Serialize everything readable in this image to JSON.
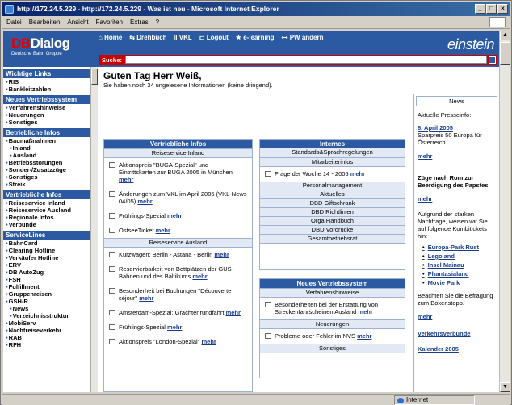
{
  "window": {
    "title": "http://172.24.5.229 - http://172.24.5.229 - Was ist neu - Microsoft Internet Explorer"
  },
  "menubar": [
    "Datei",
    "Bearbeiten",
    "Ansicht",
    "Favoriten",
    "Extras",
    "?"
  ],
  "header": {
    "brand_db": "DB",
    "brand_dialog": "Dialog",
    "brand_sub": "Deutsche Bahn Gruppe",
    "nav": [
      "Home",
      "Drehbuch",
      "VKL",
      "Logout",
      "e-learning",
      "PW ändern"
    ],
    "einstein": "einstein",
    "search_label": "Suche:"
  },
  "leftnav": [
    {
      "head": "Wichtige Links",
      "items": [
        {
          "t": "RIS"
        },
        {
          "t": "Bankleitzahlen"
        }
      ]
    },
    {
      "head": "Neues Vertriebssystem",
      "items": [
        {
          "t": "Verfahrenshinweise"
        },
        {
          "t": "Neuerungen"
        },
        {
          "t": "Sonstiges"
        }
      ]
    },
    {
      "head": "Betriebliche Infos",
      "items": [
        {
          "t": "Baumaßnahmen"
        },
        {
          "t": "Inland",
          "sub": true
        },
        {
          "t": "Ausland",
          "sub": true
        },
        {
          "t": "Betriebsstörungen"
        },
        {
          "t": "Sonder-/Zusatzzüge"
        },
        {
          "t": "Sonstiges"
        },
        {
          "t": "Streik"
        }
      ]
    },
    {
      "head": "Vertriebliche Infos",
      "items": [
        {
          "t": "Reiseservice Inland"
        },
        {
          "t": "Reiseservice Ausland"
        },
        {
          "t": "Regionale Infos"
        },
        {
          "t": "Verbünde"
        }
      ]
    },
    {
      "head": "ServiceLines",
      "items": [
        {
          "t": "BahnCard"
        },
        {
          "t": "Clearing Hotline"
        },
        {
          "t": "Verkäufer Hotline"
        },
        {
          "t": "ERV"
        },
        {
          "t": "DB AutoZug"
        },
        {
          "t": "FSH"
        },
        {
          "t": "Fulfillment"
        },
        {
          "t": "Gruppenreisen"
        },
        {
          "t": "GSH-R"
        },
        {
          "t": "News",
          "sub": true
        },
        {
          "t": "Verzeichnisstruktur",
          "sub": true
        },
        {
          "t": "MobiServ"
        },
        {
          "t": "Nachtreiseverkehr"
        },
        {
          "t": "RAB"
        },
        {
          "t": "RFH"
        }
      ]
    }
  ],
  "main": {
    "greeting": "Guten Tag Herr Weiß,",
    "greeting_sub": "Sie haben noch 34 ungelesene Informationen (keine dringend).",
    "more": "mehr",
    "vertrieb": {
      "head": "Vertriebliche Infos",
      "inland_head": "Reiseservice Inland",
      "inland": [
        "Aktionspreis \"BUGA-Spezial\" und Eintrittskarten zur BUGA 2005 in München",
        "Änderungen zum VKL im April 2005 (VKL-News 04/05)",
        "Frühlings-Spezial",
        "OstseeTicket"
      ],
      "ausland_head": "Reiseservice Ausland",
      "ausland": [
        "Kurzwagen: Berlin - Astana - Berlin",
        "Reservierbarkeit von Bettplätzen der GUS-Bahnen und des Baltikums",
        "Besonderheit bei Buchungen \"Découverte séjour\"",
        "Amsterdam-Spezial: Grachtenrundfahrt",
        "Frühlings-Spezial",
        "Aktionspreis \"London-Spezial\""
      ]
    },
    "internes": {
      "head": "Internes",
      "links1": [
        "Standards&Sprachregelungen"
      ],
      "mitarbeiter_head": "Mitarbeiterinfos",
      "entry": "Frage der Woche 14 - 2005",
      "links2": [
        "Personalmanagement",
        "Aktuelles",
        "DBD Giftschrank",
        "DBD Richtlinien",
        "Orga Handbuch",
        "DBD Vordrucke",
        "Gesamtbetriebsrat"
      ]
    },
    "nvs": {
      "head": "Neues Vertriebssystem",
      "sub1": "Verfahrenshinweise",
      "entry1": "Besonderheiten bei der Erstattung von Streckenfahrscheinen Ausland",
      "sub2": "Neuerungen",
      "entry2": "Probleme oder Fehler im NVS",
      "sub3": "Sonstiges"
    }
  },
  "right": {
    "news": "News",
    "presse_label": "Aktuelle Presseinfo:",
    "presse_date": "6. April 2005",
    "presse_text": "Sparpreis 50 Europa für Österreich",
    "more": "mehr",
    "zuege": "Züge nach Rom zur Beerdigung des Papstes",
    "kombi": "Aufgrund der starken Nachfrage, weisen wir Sie auf folgende Kombitickets hin:",
    "kombi_list": [
      "Europa-Park Rust",
      "Legoland",
      "Insel Mainau",
      "Phantasialand",
      "Movie Park"
    ],
    "befragung": "Beachten Sie die Befragung zum Boxenstopp.",
    "verbuende": "Verkehrsverbünde",
    "kalender": "Kalender 2005"
  },
  "status": {
    "zone": "Internet"
  }
}
